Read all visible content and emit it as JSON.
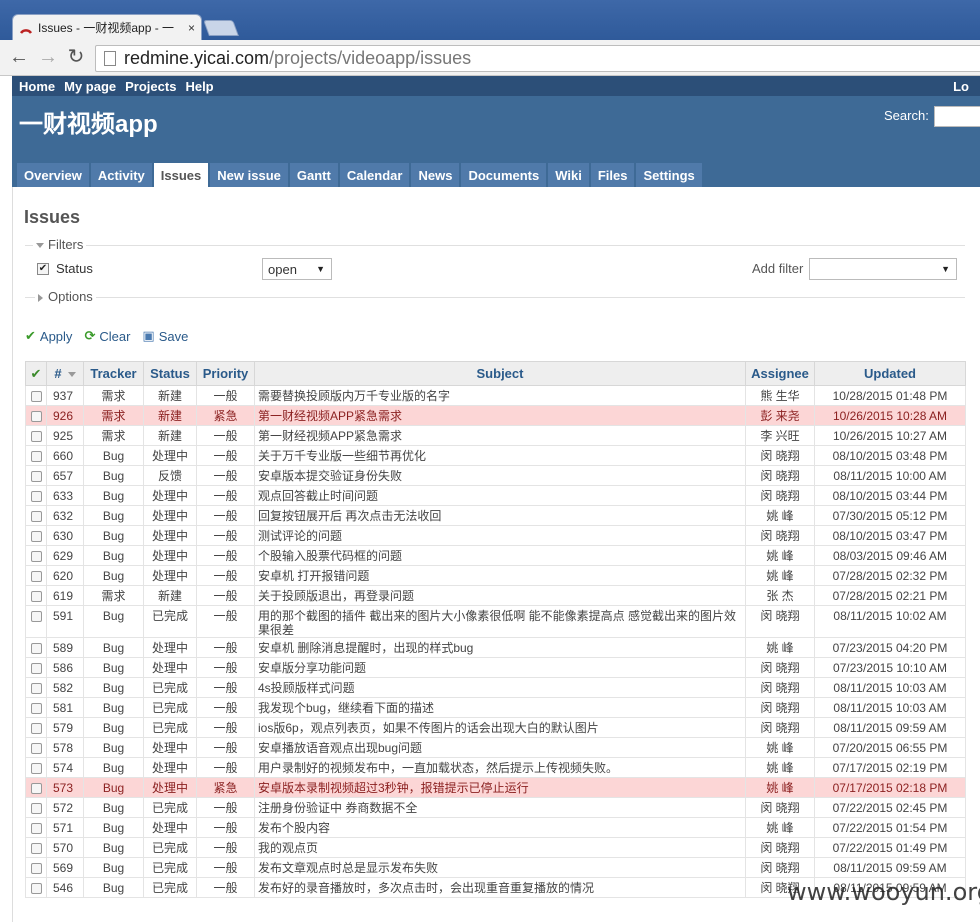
{
  "browser": {
    "tab_title": "Issues - 一财视频app - 一",
    "tab_close": "×",
    "url_host": "redmine.yicai.com",
    "url_path": "/projects/videoapp/issues"
  },
  "top_menu": {
    "items": [
      "Home",
      "My page",
      "Projects",
      "Help"
    ],
    "login": "Lo"
  },
  "header": {
    "project_title": "一财视频app",
    "search_label": "Search:"
  },
  "main_menu": {
    "tabs": [
      "Overview",
      "Activity",
      "Issues",
      "New issue",
      "Gantt",
      "Calendar",
      "News",
      "Documents",
      "Wiki",
      "Files",
      "Settings"
    ],
    "selected": "Issues"
  },
  "page": {
    "heading": "Issues",
    "filters_legend": "Filters",
    "status_label": "Status",
    "status_operator": "open",
    "add_filter_label": "Add filter",
    "add_filter_value": "",
    "options_legend": "Options",
    "apply": "Apply",
    "clear": "Clear",
    "save": "Save"
  },
  "table": {
    "headers": [
      "#",
      "Tracker",
      "Status",
      "Priority",
      "Subject",
      "Assignee",
      "Updated"
    ],
    "rows": [
      {
        "id": "937",
        "tracker": "需求",
        "status": "新建",
        "priority": "一般",
        "subject": "需要替换投顾版内万千专业版的名字",
        "assignee": "熊 生华",
        "updated": "10/28/2015 01:48 PM",
        "urgent": false
      },
      {
        "id": "926",
        "tracker": "需求",
        "status": "新建",
        "priority": "紧急",
        "subject": "第一财经视频APP紧急需求",
        "assignee": "彭 来尧",
        "updated": "10/26/2015 10:28 AM",
        "urgent": true
      },
      {
        "id": "925",
        "tracker": "需求",
        "status": "新建",
        "priority": "一般",
        "subject": "第一财经视频APP紧急需求",
        "assignee": "李 兴旺",
        "updated": "10/26/2015 10:27 AM",
        "urgent": false
      },
      {
        "id": "660",
        "tracker": "Bug",
        "status": "处理中",
        "priority": "一般",
        "subject": "关于万千专业版一些细节再优化",
        "assignee": "闵 晓翔",
        "updated": "08/10/2015 03:48 PM",
        "urgent": false
      },
      {
        "id": "657",
        "tracker": "Bug",
        "status": "反馈",
        "priority": "一般",
        "subject": "安卓版本提交验证身份失败",
        "assignee": "闵 晓翔",
        "updated": "08/11/2015 10:00 AM",
        "urgent": false
      },
      {
        "id": "633",
        "tracker": "Bug",
        "status": "处理中",
        "priority": "一般",
        "subject": "观点回答截止时间问题",
        "assignee": "闵 晓翔",
        "updated": "08/10/2015 03:44 PM",
        "urgent": false
      },
      {
        "id": "632",
        "tracker": "Bug",
        "status": "处理中",
        "priority": "一般",
        "subject": "回复按钮展开后 再次点击无法收回",
        "assignee": "姚 峰",
        "updated": "07/30/2015 05:12 PM",
        "urgent": false
      },
      {
        "id": "630",
        "tracker": "Bug",
        "status": "处理中",
        "priority": "一般",
        "subject": "测试评论的问题",
        "assignee": "闵 晓翔",
        "updated": "08/10/2015 03:47 PM",
        "urgent": false
      },
      {
        "id": "629",
        "tracker": "Bug",
        "status": "处理中",
        "priority": "一般",
        "subject": "个股输入股票代码框的问题",
        "assignee": "姚 峰",
        "updated": "08/03/2015 09:46 AM",
        "urgent": false
      },
      {
        "id": "620",
        "tracker": "Bug",
        "status": "处理中",
        "priority": "一般",
        "subject": "安卓机 打开报错问题",
        "assignee": "姚 峰",
        "updated": "07/28/2015 02:32 PM",
        "urgent": false
      },
      {
        "id": "619",
        "tracker": "需求",
        "status": "新建",
        "priority": "一般",
        "subject": "关于投顾版退出，再登录问题",
        "assignee": "张 杰",
        "updated": "07/28/2015 02:21 PM",
        "urgent": false
      },
      {
        "id": "591",
        "tracker": "Bug",
        "status": "已完成",
        "priority": "一般",
        "subject": "用的那个截图的插件 截出来的图片大小像素很低啊 能不能像素提高点 感觉截出来的图片效果很差",
        "assignee": "闵 晓翔",
        "updated": "08/11/2015 10:02 AM",
        "urgent": false
      },
      {
        "id": "589",
        "tracker": "Bug",
        "status": "处理中",
        "priority": "一般",
        "subject": "安卓机 删除消息提醒时，出现的样式bug",
        "assignee": "姚 峰",
        "updated": "07/23/2015 04:20 PM",
        "urgent": false
      },
      {
        "id": "586",
        "tracker": "Bug",
        "status": "处理中",
        "priority": "一般",
        "subject": "安卓版分享功能问题",
        "assignee": "闵 晓翔",
        "updated": "07/23/2015 10:10 AM",
        "urgent": false
      },
      {
        "id": "582",
        "tracker": "Bug",
        "status": "已完成",
        "priority": "一般",
        "subject": "4s投顾版样式问题",
        "assignee": "闵 晓翔",
        "updated": "08/11/2015 10:03 AM",
        "urgent": false
      },
      {
        "id": "581",
        "tracker": "Bug",
        "status": "已完成",
        "priority": "一般",
        "subject": "我发现个bug，继续看下面的描述",
        "assignee": "闵 晓翔",
        "updated": "08/11/2015 10:03 AM",
        "urgent": false
      },
      {
        "id": "579",
        "tracker": "Bug",
        "status": "已完成",
        "priority": "一般",
        "subject": "ios版6p，观点列表页，如果不传图片的话会出现大白的默认图片",
        "assignee": "闵 晓翔",
        "updated": "08/11/2015 09:59 AM",
        "urgent": false
      },
      {
        "id": "578",
        "tracker": "Bug",
        "status": "处理中",
        "priority": "一般",
        "subject": "安卓播放语音观点出现bug问题",
        "assignee": "姚 峰",
        "updated": "07/20/2015 06:55 PM",
        "urgent": false
      },
      {
        "id": "574",
        "tracker": "Bug",
        "status": "处理中",
        "priority": "一般",
        "subject": "用户录制好的视频发布中，一直加载状态，然后提示上传视频失败。",
        "assignee": "姚 峰",
        "updated": "07/17/2015 02:19 PM",
        "urgent": false
      },
      {
        "id": "573",
        "tracker": "Bug",
        "status": "处理中",
        "priority": "紧急",
        "subject": "安卓版本录制视频超过3秒钟，报错提示已停止运行",
        "assignee": "姚 峰",
        "updated": "07/17/2015 02:18 PM",
        "urgent": true
      },
      {
        "id": "572",
        "tracker": "Bug",
        "status": "已完成",
        "priority": "一般",
        "subject": "注册身份验证中 券商数据不全",
        "assignee": "闵 晓翔",
        "updated": "07/22/2015 02:45 PM",
        "urgent": false
      },
      {
        "id": "571",
        "tracker": "Bug",
        "status": "处理中",
        "priority": "一般",
        "subject": "发布个股内容",
        "assignee": "姚 峰",
        "updated": "07/22/2015 01:54 PM",
        "urgent": false
      },
      {
        "id": "570",
        "tracker": "Bug",
        "status": "已完成",
        "priority": "一般",
        "subject": "我的观点页",
        "assignee": "闵 晓翔",
        "updated": "07/22/2015 01:49 PM",
        "urgent": false
      },
      {
        "id": "569",
        "tracker": "Bug",
        "status": "已完成",
        "priority": "一般",
        "subject": "发布文章观点时总是显示发布失败",
        "assignee": "闵 晓翔",
        "updated": "08/11/2015 09:59 AM",
        "urgent": false
      },
      {
        "id": "546",
        "tracker": "Bug",
        "status": "已完成",
        "priority": "一般",
        "subject": "发布好的录音播放时，多次点击时，会出现重音重复播放的情况",
        "assignee": "闵 晓翔",
        "updated": "08/11/2015 09:59 AM",
        "urgent": false
      }
    ]
  },
  "watermark": "www.wooyun.org",
  "colors": {
    "header": "#3e6a96",
    "top_menu": "#2c4f78",
    "tab": "#507aaa",
    "urgent_row": "#fcd6d6",
    "link": "#2a5a8a"
  }
}
